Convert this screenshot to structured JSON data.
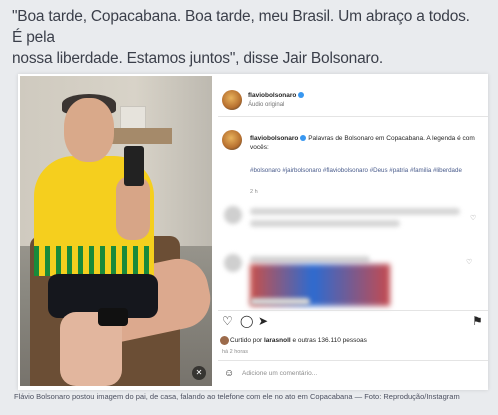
{
  "article": {
    "quote_line1": "\"Boa tarde, Copacabana. Boa tarde, meu Brasil. Um abraço a todos. É pela",
    "quote_line2": "nossa liberdade. Estamos juntos\", disse Jair Bolsonaro.",
    "caption": "Flávio Bolsonaro postou imagem do pai, de casa, falando ao telefone com ele no ato em Copacabana — Foto: Reprodução/Instagram"
  },
  "post": {
    "username": "flaviobolsonaro",
    "audio_label": "Áudio original",
    "caption_user": "flaviobolsonaro",
    "caption_text": "Palavras de Bolsonaro em Copacabana. A legenda é com vocês:",
    "hashtags": "#bolsonaro #jairbolsonaro #flaviobolsonaro #Deus #patria #familia #liberdade",
    "time_ago": "2 h",
    "liked_prefix": "Curtido por",
    "liked_user": "larasnoll",
    "liked_rest": "e outras 136.110 pessoas",
    "post_age": "há 2 horas",
    "comment_placeholder": "Adicione um comentário..."
  },
  "icons": {
    "like": "heart-icon",
    "comment": "comment-icon",
    "share": "send-icon",
    "save": "bookmark-icon",
    "verified": "verified-badge-icon",
    "emoji": "emoji-icon",
    "mute": "muted-speaker-icon"
  },
  "colors": {
    "hashtag": "#4a5c8c",
    "verified": "#3897f0",
    "page_bg": "#e9ebee"
  }
}
